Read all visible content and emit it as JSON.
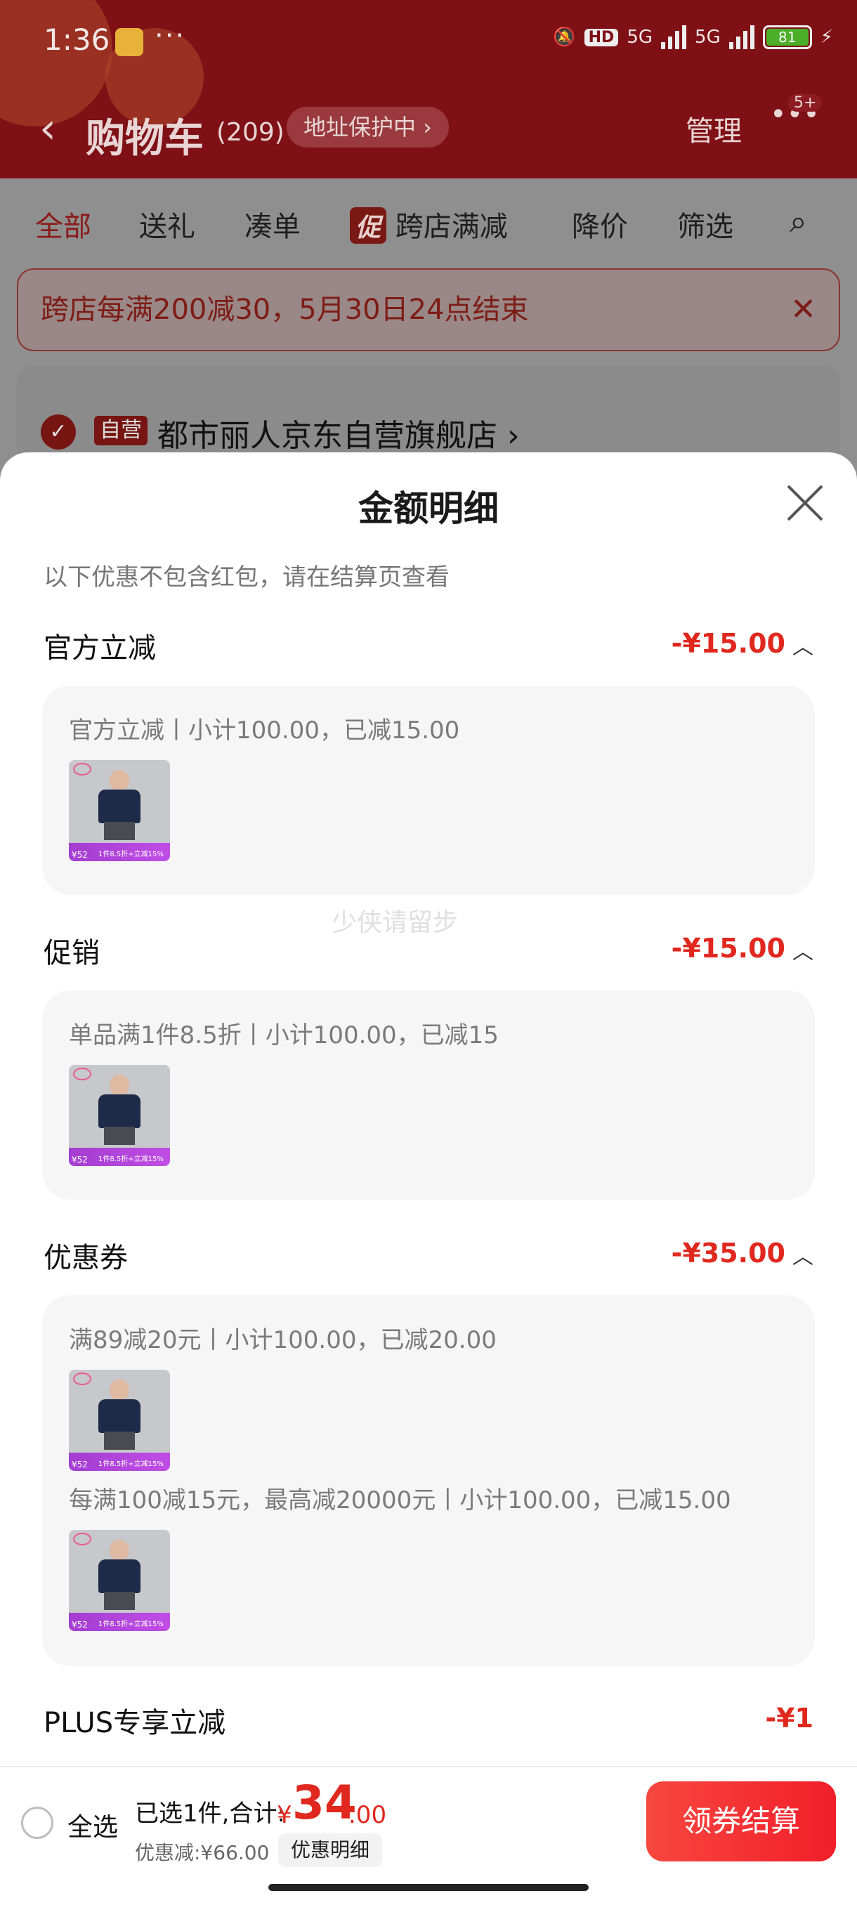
{
  "status_bar": {
    "time": "1:36",
    "dots": "···",
    "hd": "HD",
    "net1": "5G",
    "net2": "5G",
    "battery": "81"
  },
  "nav": {
    "back": "‹",
    "title": "购物车",
    "count": "(209)",
    "address_pill": "地址保护中 ›",
    "manage": "管理",
    "more": "•••",
    "badge": "5+"
  },
  "filters": {
    "all": "全部",
    "gift": "送礼",
    "bundle": "凑单",
    "promo_icon": "促",
    "cross_store": "跨店满减",
    "price_drop": "降价",
    "filter": "筛选"
  },
  "banner": {
    "text": "跨店每满200减30，5月30日24点结束",
    "close": "✕"
  },
  "store": {
    "check": "✓",
    "self_tag": "自营",
    "name": "都市丽人京东自营旗舰店 ›"
  },
  "sheet": {
    "title": "金额明细",
    "note": "以下优惠不包含红包，请在结算页查看",
    "watermark": "少侠请留步",
    "sections": [
      {
        "label": "官方立减",
        "amount": "-¥15.00",
        "lines": [
          "官方立减丨小计100.00，已减15.00"
        ]
      },
      {
        "label": "促销",
        "amount": "-¥15.00",
        "lines": [
          "单品满1件8.5折丨小计100.00，已减15"
        ]
      },
      {
        "label": "优惠券",
        "amount": "-¥35.00",
        "lines": [
          "满89减20元丨小计100.00，已减20.00",
          "每满100减15元，最高减20000元丨小计100.00，已减15.00"
        ]
      },
      {
        "label": "PLUS专享立减",
        "amount": "-¥1"
      }
    ],
    "chevron": "︿",
    "thumb_price": "¥52",
    "thumb_caption": "1件8.5折+立减15%"
  },
  "bottom_bar": {
    "select_all": "全选",
    "selected_total_label": "已选1件,合计:",
    "yen": "¥",
    "total_int": "34",
    "total_dec": ".00",
    "discount": "优惠减:¥66.00",
    "detail_button": "优惠明细",
    "checkout_button": "领券结算"
  },
  "colors": {
    "accent_red": "#e0281e",
    "header_red": "#7e1016",
    "checkout_gradient": "#f21e2a"
  }
}
